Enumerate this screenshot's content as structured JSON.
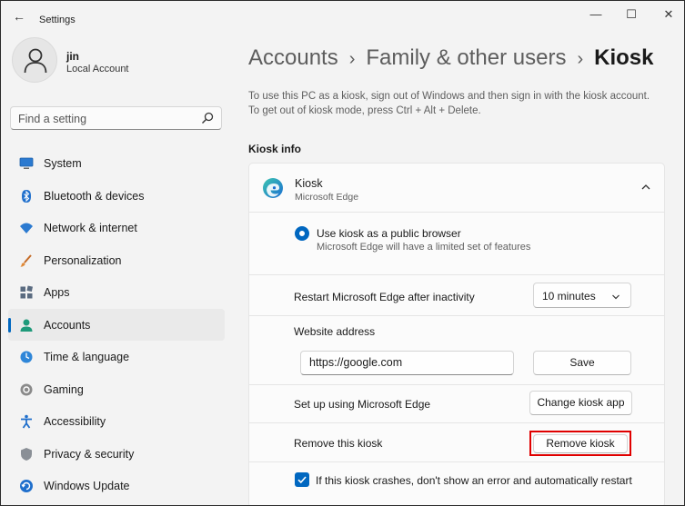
{
  "window": {
    "title": "Settings",
    "back_glyph": "←",
    "minimize_glyph": "—",
    "maximize_glyph": "☐",
    "close_glyph": "✕"
  },
  "user": {
    "name": "jin",
    "account_type": "Local Account"
  },
  "search": {
    "placeholder": "Find a setting"
  },
  "sidebar": {
    "items": [
      {
        "label": "System",
        "icon": "monitor-icon",
        "active": false
      },
      {
        "label": "Bluetooth & devices",
        "icon": "bluetooth-icon",
        "active": false
      },
      {
        "label": "Network & internet",
        "icon": "wifi-icon",
        "active": false
      },
      {
        "label": "Personalization",
        "icon": "brush-icon",
        "active": false
      },
      {
        "label": "Apps",
        "icon": "apps-icon",
        "active": false
      },
      {
        "label": "Accounts",
        "icon": "person-icon",
        "active": true
      },
      {
        "label": "Time & language",
        "icon": "globe-clock-icon",
        "active": false
      },
      {
        "label": "Gaming",
        "icon": "gamepad-icon",
        "active": false
      },
      {
        "label": "Accessibility",
        "icon": "accessibility-icon",
        "active": false
      },
      {
        "label": "Privacy & security",
        "icon": "shield-icon",
        "active": false
      },
      {
        "label": "Windows Update",
        "icon": "update-icon",
        "active": false
      }
    ]
  },
  "breadcrumb": {
    "parts": [
      "Accounts",
      "Family & other users"
    ],
    "separator": "›",
    "current": "Kiosk"
  },
  "description": {
    "line1": "To use this PC as a kiosk, sign out of Windows and then sign in with the kiosk account.",
    "line2": "To get out of kiosk mode, press Ctrl + Alt + Delete."
  },
  "kiosk_info": {
    "section_title": "Kiosk info",
    "kiosk_name": "Kiosk",
    "kiosk_app": "Microsoft Edge",
    "mode_option": {
      "label": "Use kiosk as a public browser",
      "sublabel": "Microsoft Edge will have a limited set of features",
      "selected": true
    },
    "restart": {
      "label": "Restart Microsoft Edge after inactivity",
      "value": "10 minutes"
    },
    "website": {
      "label": "Website address",
      "value": "https://google.com",
      "save_label": "Save"
    },
    "setup": {
      "label": "Set up using Microsoft Edge",
      "button_label": "Change kiosk app"
    },
    "remove": {
      "label": "Remove this kiosk",
      "button_label": "Remove kiosk",
      "highlight_color": "#e00000"
    },
    "crash_option": {
      "label": "If this kiosk crashes, don't show an error and automatically restart",
      "checked": true
    }
  },
  "colors": {
    "accent": "#0067c0",
    "background": "#f3f3f3"
  }
}
